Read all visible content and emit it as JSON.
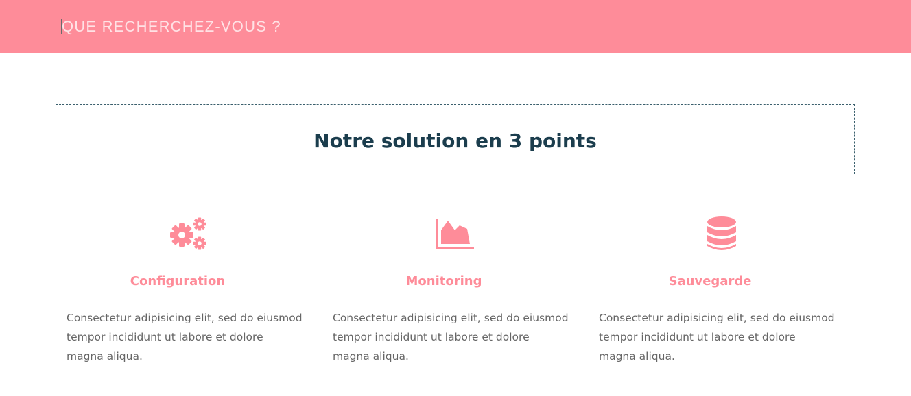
{
  "search": {
    "placeholder": "QUE RECHERCHEZ-VOUS ?"
  },
  "section": {
    "title": "Notre solution en 3 points"
  },
  "features": [
    {
      "icon": "gears-icon",
      "title": "Configuration",
      "text": "Consectetur adipisicing elit, sed do eiusmod tempor incididunt ut labore et dolore magna aliqua."
    },
    {
      "icon": "area-chart-icon",
      "title": "Monitoring",
      "text": "Consectetur adipisicing elit, sed do eiusmod tempor incididunt ut labore et dolore magna aliqua."
    },
    {
      "icon": "database-icon",
      "title": "Sauvegarde",
      "text": "Consectetur adipisicing elit, sed do eiusmod tempor incididunt ut labore et dolore magna aliqua."
    }
  ],
  "colors": {
    "accent": "#fe8c99",
    "heading": "#1b3d4d",
    "body_text": "#666666"
  }
}
